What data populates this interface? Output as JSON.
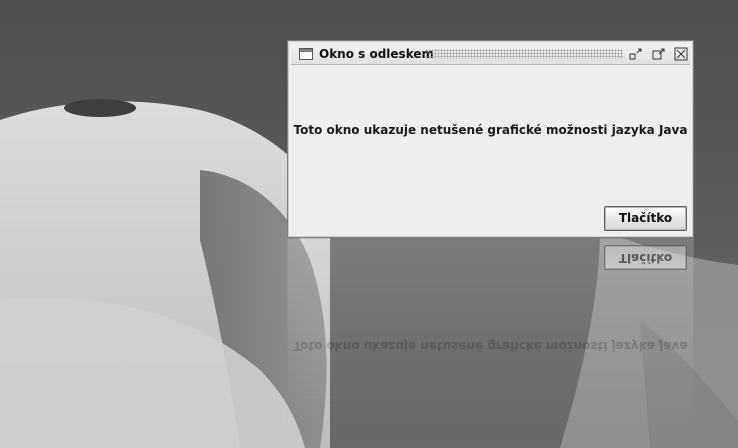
{
  "window": {
    "title": "Okno s odleskem",
    "message": "Toto okno ukazuje netušené grafické možnosti jazyka Java",
    "button_label": "Tlačítko",
    "controls": {
      "iconify_icon": "iconify-icon",
      "maximize_icon": "maximize-icon",
      "close_icon": "close-icon"
    }
  },
  "reflection": {
    "message": "Toto okno ukazuje netušené grafické možnosti jazyka Java",
    "button_label": "Tlačítko"
  },
  "colors": {
    "window_bg": "#eeeeee",
    "titlebar_bg": "#e5e5e5",
    "desktop_shadow": "#4a4a4a",
    "desktop_light": "#d6d6d6"
  }
}
